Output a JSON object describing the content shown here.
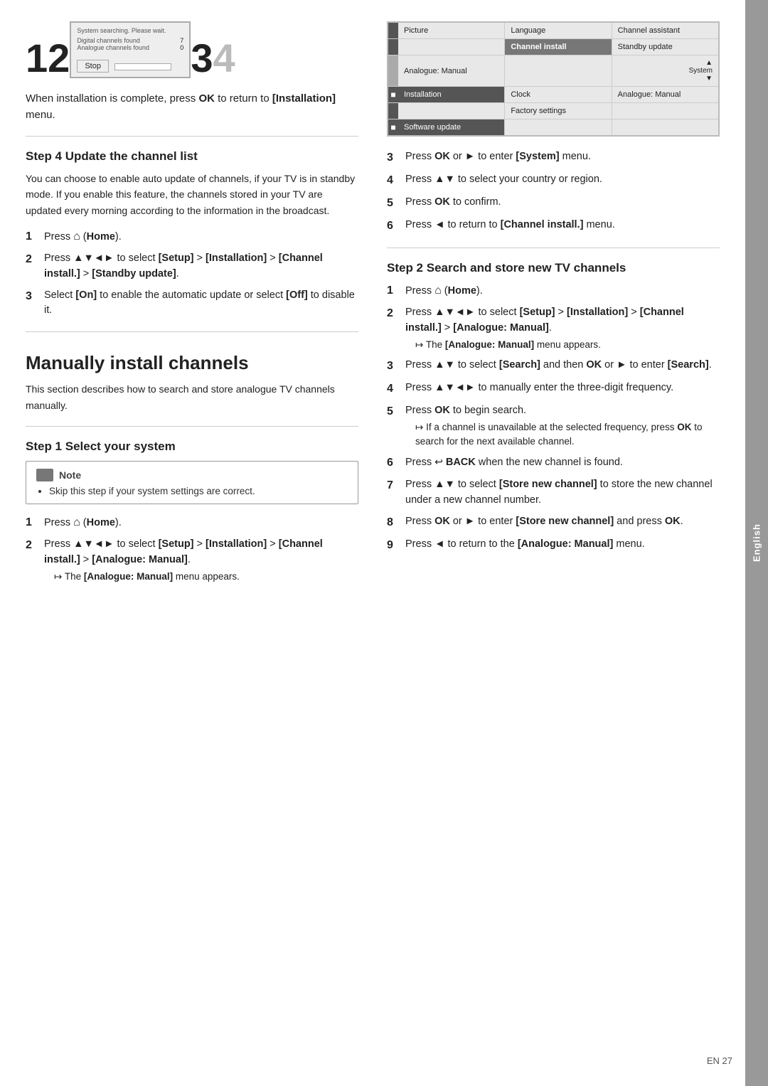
{
  "sidebar": {
    "label": "English"
  },
  "page_number": "EN  27",
  "top_section": {
    "tv_screen": {
      "searching_text": "System searching. Please wait.",
      "digital_label": "Digital channels found",
      "digital_count": "7",
      "analogue_label": "Analogue channels found",
      "analogue_count": "0",
      "stop_button": "Stop"
    },
    "step_numbers": [
      "1",
      "2",
      "3",
      "4"
    ],
    "step3_text": "When installation is complete, press",
    "step3_bold": "OK",
    "step3_text2": "to return to",
    "step3_bracket": "[Installation]",
    "step3_text3": "menu."
  },
  "step4": {
    "heading": "Step 4 Update the channel list",
    "body": "You can choose to enable auto update of channels, if your TV is in standby mode. If you enable this feature, the channels stored in your TV are updated every morning according to the information in the broadcast.",
    "steps": [
      {
        "num": "1",
        "text": "Press",
        "icon": "home",
        "bracket": "(Home)."
      },
      {
        "num": "2",
        "text": "Press ▲▼◄► to select",
        "bracket1": "[Setup]",
        "text2": ">",
        "bracket2": "[Installation]",
        "text3": ">",
        "bracket3": "[Channel install.]",
        "text4": ">",
        "bracket4": "[Standby update]",
        "text5": "."
      },
      {
        "num": "3",
        "text": "Select",
        "bracket1": "[On]",
        "text2": "to enable the automatic update or select",
        "bracket2": "[Off]",
        "text3": "to disable it."
      }
    ]
  },
  "big_section": {
    "title": "Manually install channels",
    "body": "This section describes how to search and store analogue TV channels manually."
  },
  "step1": {
    "heading": "Step 1 Select your system",
    "note_header": "Note",
    "note_bullet": "Skip this step if your system settings are correct.",
    "steps": [
      {
        "num": "1",
        "text": "Press",
        "icon": "home",
        "bracket": "(Home)."
      },
      {
        "num": "2",
        "text": "Press ▲▼◄► to select",
        "bracket1": "[Setup]",
        "text2": ">",
        "bracket2": "[Installation]",
        "text3": ">",
        "bracket3": "[Channel install.]",
        "text4": ">",
        "bracket4": "[Analogue: Manual]",
        "text5": ".",
        "note": "The [Analogue: Manual] menu appears."
      }
    ]
  },
  "right_menu": {
    "rows": [
      [
        "Picture",
        "Language",
        "Channel assistant"
      ],
      [
        "",
        "Channel install",
        "Standby update"
      ],
      [
        "Analogue: Manual",
        "",
        "▲ System ▼"
      ],
      [
        "Installation",
        "Clock",
        "Analogue: Manual"
      ],
      [
        "",
        "Factory settings",
        ""
      ],
      [
        "Software update",
        "",
        ""
      ]
    ]
  },
  "right_steps_system": [
    {
      "num": "3",
      "text": "Press OK or ► to enter",
      "bracket": "[System]",
      "text2": "menu."
    },
    {
      "num": "4",
      "text": "Press ▲▼ to select your country or region."
    },
    {
      "num": "5",
      "text": "Press",
      "bold": "OK",
      "text2": "to confirm."
    },
    {
      "num": "6",
      "text": "Press ◄ to return to",
      "bracket": "[Channel install.]",
      "text2": "menu."
    }
  ],
  "step2_search": {
    "heading": "Step 2 Search and store new TV channels",
    "steps": [
      {
        "num": "1",
        "text": "Press",
        "icon": "home",
        "bracket": "(Home)."
      },
      {
        "num": "2",
        "text": "Press ▲▼◄► to select",
        "bracket1": "[Setup]",
        "text2": ">",
        "bracket2": "[Installation]",
        "text3": ">",
        "bracket3": "[Channel install.]",
        "text4": ">",
        "bracket4": "[Analogue: Manual]",
        "text5": ".",
        "note": "The [Analogue: Manual] menu appears."
      },
      {
        "num": "3",
        "text": "Press ▲▼ to select",
        "bracket1": "[Search]",
        "text2": "and then OK or ► to enter",
        "bracket2": "[Search]",
        "text3": "."
      },
      {
        "num": "4",
        "text": "Press ▲▼◄► to manually enter the three-digit frequency."
      },
      {
        "num": "5",
        "text": "Press",
        "bold": "OK",
        "text2": "to begin search.",
        "sub": "If a channel is unavailable at the selected frequency, press OK to search for the next available channel."
      },
      {
        "num": "6",
        "text": "Press",
        "icon": "back",
        "bold": "BACK",
        "text2": "when the new channel is found."
      },
      {
        "num": "7",
        "text": "Press ▲▼ to select",
        "bracket1": "[Store new channel]",
        "text2": "to store the new channel under a new channel number."
      },
      {
        "num": "8",
        "text": "Press OK or ► to enter",
        "bracket1": "[Store new channel]",
        "text2": "and press",
        "bold": "OK",
        "text3": "."
      },
      {
        "num": "9",
        "text": "Press ◄ to return to the",
        "bracket1": "[Analogue: Manual]",
        "text2": "menu."
      }
    ]
  }
}
